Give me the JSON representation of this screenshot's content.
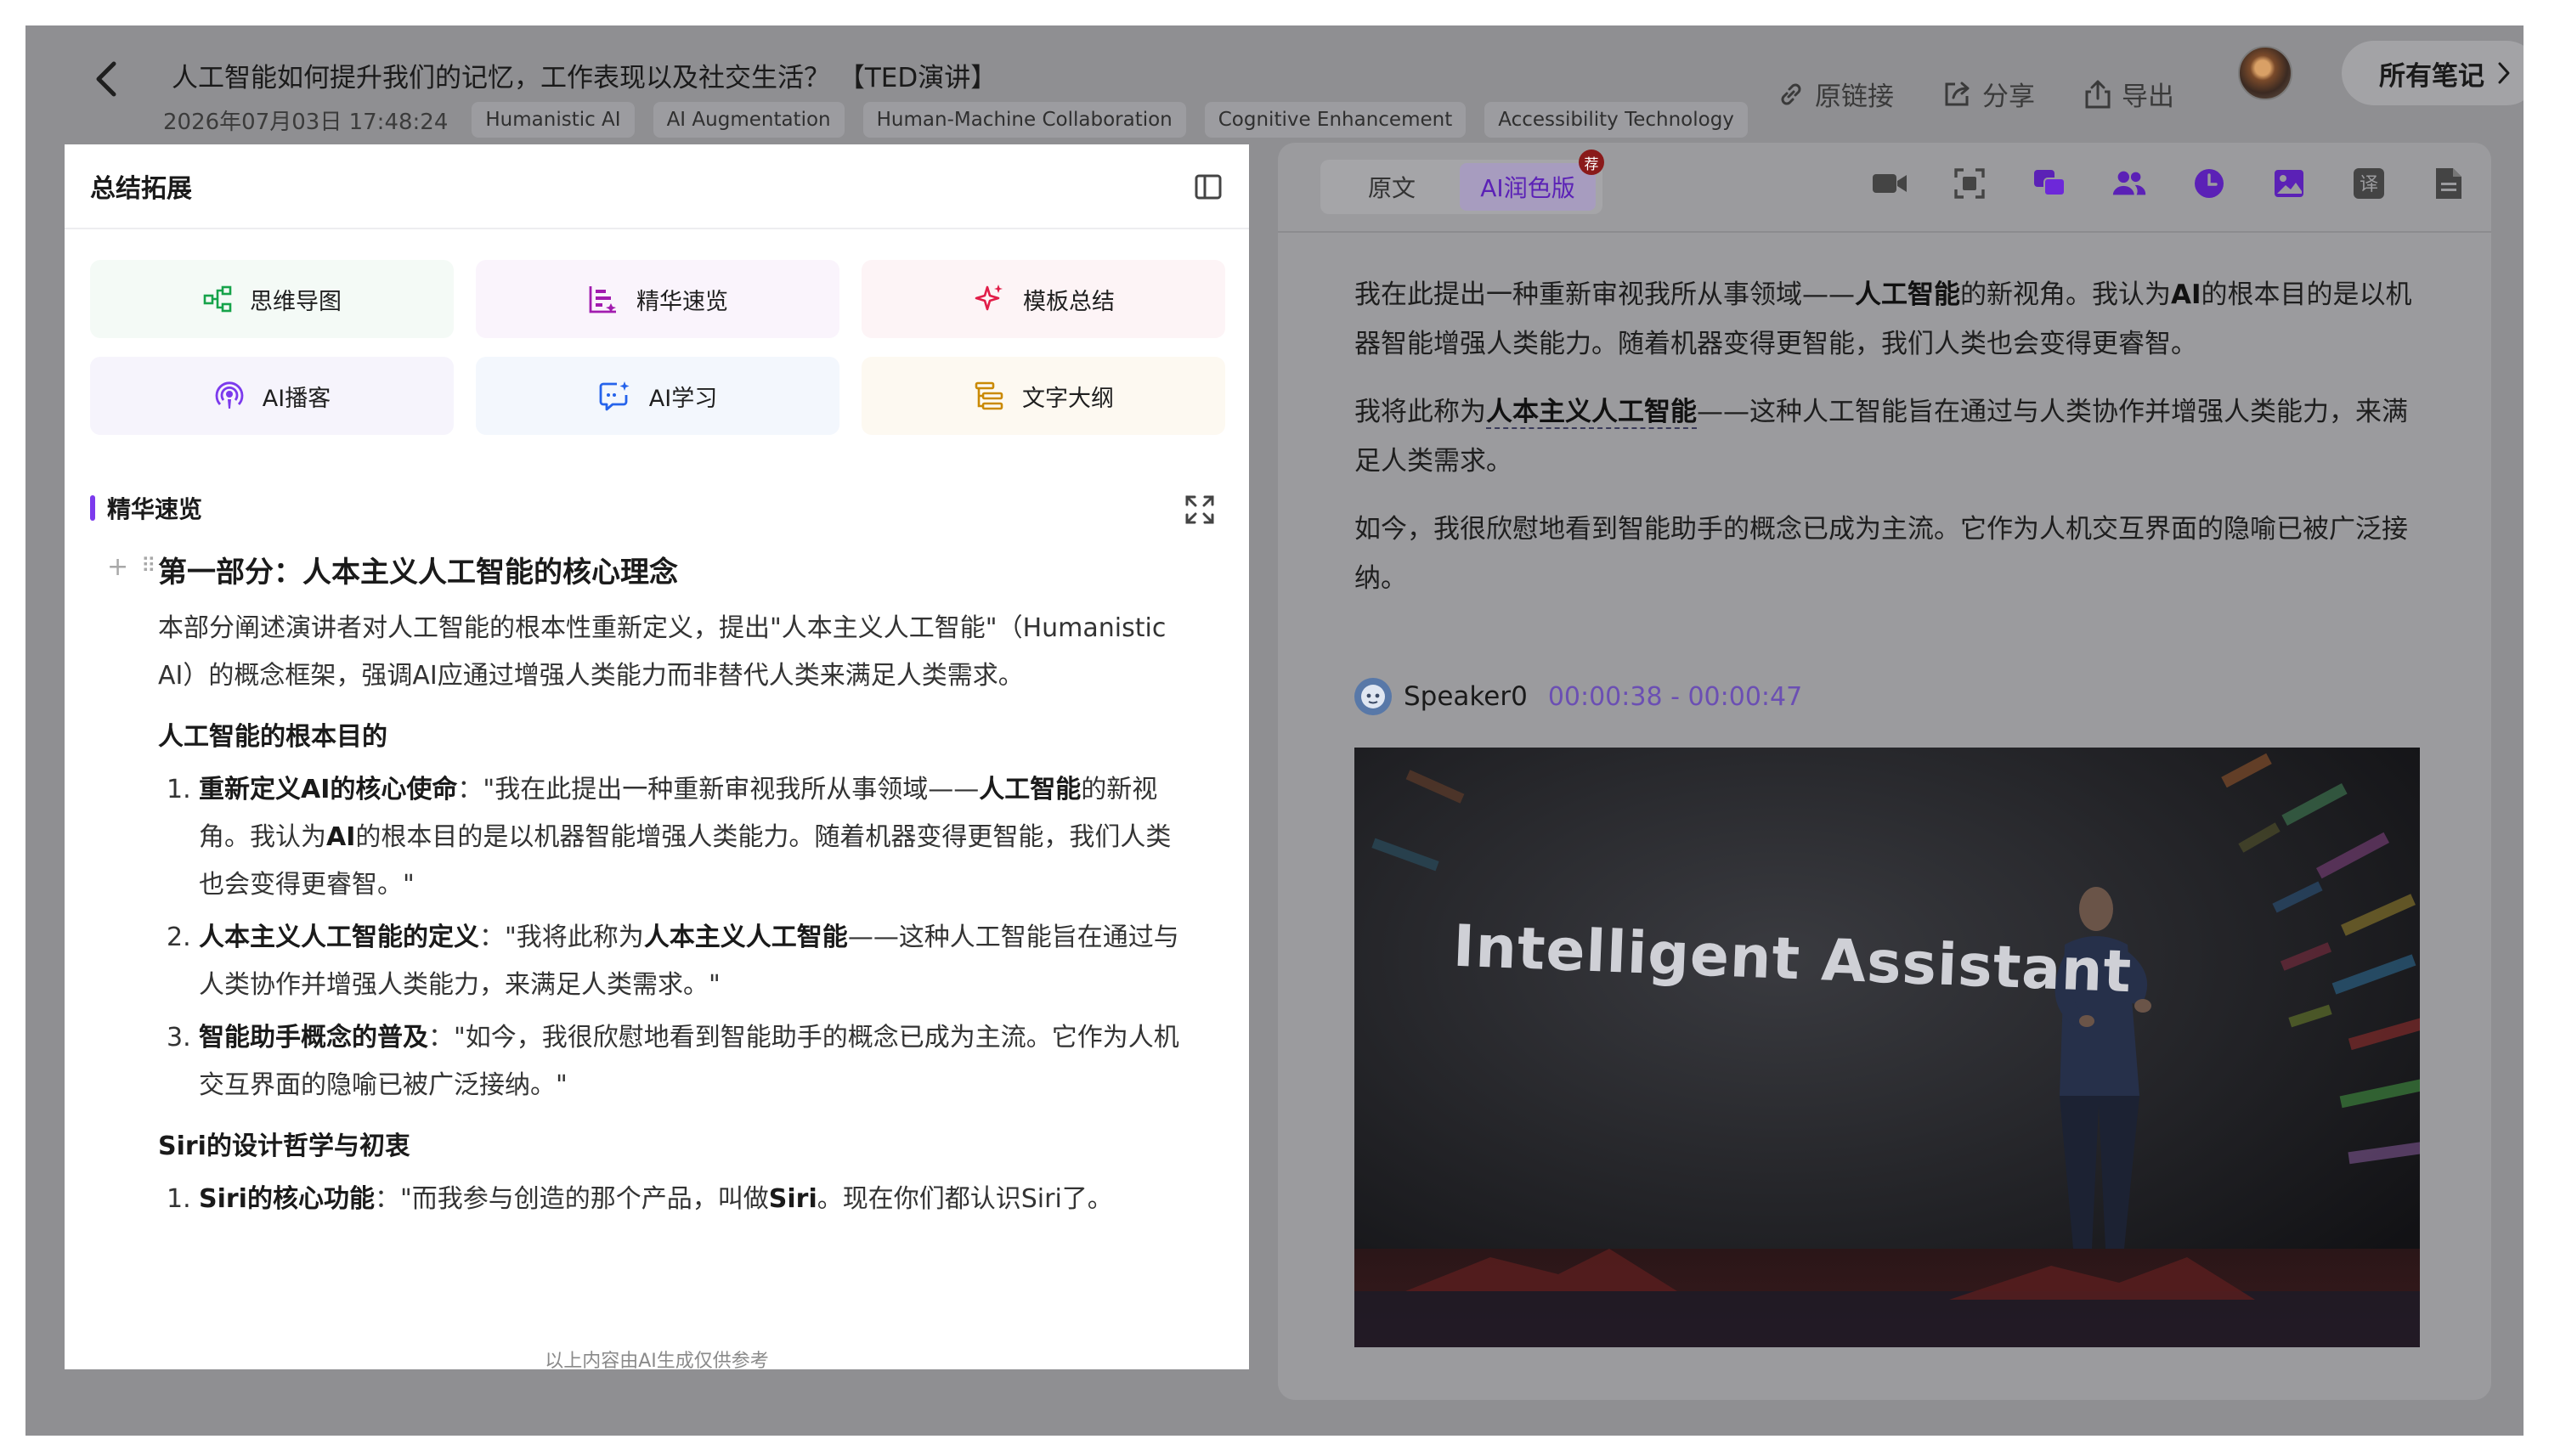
{
  "header": {
    "back_icon": "chevron-left-icon",
    "title": "人工智能如何提升我们的记忆，工作表现以及社交生活？ 【TED演讲】",
    "datetime": "2026年07月03日 17:48:24",
    "tags": [
      "Humanistic AI",
      "AI Augmentation",
      "Human-Machine Collaboration",
      "Cognitive Enhancement",
      "Accessibility Technology"
    ],
    "actions": [
      {
        "label": "原链接",
        "icon": "link-icon"
      },
      {
        "label": "分享",
        "icon": "share-icon"
      },
      {
        "label": "导出",
        "icon": "export-icon"
      }
    ],
    "notes_button": "所有笔记"
  },
  "left_panel": {
    "title": "总结拓展",
    "tools": [
      {
        "label": "思维导图",
        "icon": "mindmap-icon",
        "color": "#16a34a"
      },
      {
        "label": "精华速览",
        "icon": "essence-icon",
        "color": "#a21caf"
      },
      {
        "label": "模板总结",
        "icon": "sparkle-icon",
        "color": "#e11d48"
      },
      {
        "label": "AI播客",
        "icon": "podcast-icon",
        "color": "#7c3aed"
      },
      {
        "label": "AI学习",
        "icon": "ai-learn-icon",
        "color": "#2563eb"
      },
      {
        "label": "文字大纲",
        "icon": "outline-icon",
        "color": "#ca8a04"
      }
    ],
    "section_title": "精华速览",
    "part_heading": "第一部分：人本主义人工智能的核心理念",
    "intro": "本部分阐述演讲者对人工智能的根本性重新定义，提出\"人本主义人工智能\"（Humanistic AI）的概念框架，强调AI应通过增强人类能力而非替代人类来满足人类需求。",
    "subsection1": "人工智能的根本目的",
    "items1": [
      {
        "num": "1.",
        "bold": "重新定义AI的核心使命",
        "text": "：\"我在此提出一种重新审视我所从事领域——",
        "bold2": "人工智能",
        "text2": "的新视角。我认为",
        "bold3": "AI",
        "text3": "的根本目的是以机器智能增强人类能力。随着机器变得更智能，我们人类也会变得更睿智。\""
      },
      {
        "num": "2.",
        "bold": "人本主义人工智能的定义",
        "text": "：\"我将此称为",
        "bold2": "人本主义人工智能",
        "text2": "——这种人工智能旨在通过与人类协作并增强人类能力，来满足人类需求。\""
      },
      {
        "num": "3.",
        "bold": "智能助手概念的普及",
        "text": "：\"如今，我很欣慰地看到智能助手的概念已成为主流。它作为人机交互界面的隐喻已被广泛接纳。\""
      }
    ],
    "subsection2": "Siri的设计哲学与初衷",
    "items2": [
      {
        "num": "1.",
        "bold": "Siri的核心功能",
        "text": "：\"而我参与创造的那个产品，叫做",
        "bold2": "Siri",
        "text2": "。现在你们都认识Siri了。"
      }
    ],
    "disclaimer": "以上内容由AI生成仅供参考"
  },
  "right_panel": {
    "tabs": [
      "原文",
      "AI润色版"
    ],
    "active_tab": "AI润色版",
    "badge": "荐",
    "tool_icons": [
      "video-camera-icon",
      "screenshot-icon",
      "chat-bubbles-icon",
      "people-icon",
      "clock-icon",
      "image-icon",
      "translate-icon",
      "document-icon"
    ],
    "translate_glyph": "译",
    "para1": {
      "a": "我在此提出一种重新审视我所从事领域——",
      "b": "人工智能",
      "c": "的新视角。我认为",
      "d": "AI",
      "e": "的根本目的是以机器智能增强人类能力。随着机器变得更智能，我们人类也会变得更睿智。"
    },
    "para2": {
      "a": "我将此称为",
      "b": "人本主义人工智能",
      "c": "——这种人工智能旨在通过与人类协作并增强人类能力，来满足人类需求。"
    },
    "para3": "如今，我很欣慰地看到智能助手的概念已成为主流。它作为人机交互界面的隐喻已被广泛接纳。",
    "speaker": {
      "name": "Speaker0",
      "time": "00:00:38 - 00:00:47"
    },
    "video_slide_text": "Intelligent Assistant"
  },
  "colors": {
    "accent": "#7c3aed",
    "overlay": "#8f8f92",
    "speaker_time": "#6b4fb3"
  }
}
